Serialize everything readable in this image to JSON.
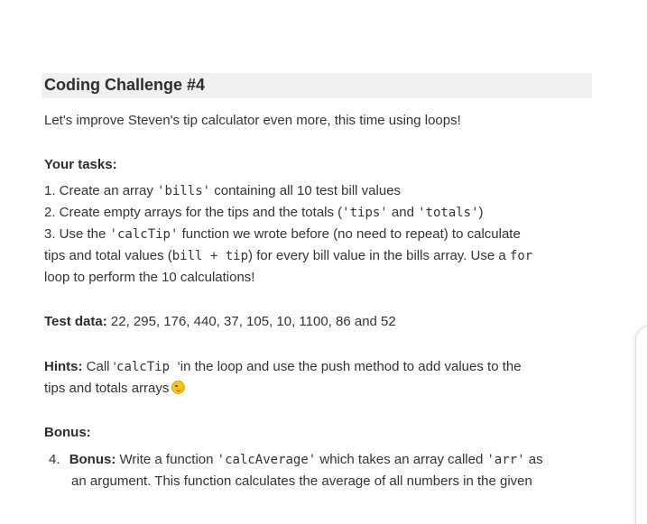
{
  "title": "Coding Challenge #4",
  "intro": "Let's improve Steven's tip calculator even more, this time using loops!",
  "tasks_heading": "Your tasks:",
  "task1": {
    "prefix": "1. Create an array ",
    "code": "'bills'",
    "suffix": " containing all 10 test bill values"
  },
  "task2": {
    "prefix": "2. Create empty arrays for the tips and the totals (",
    "code1": "'tips'",
    "mid": " and ",
    "code2": "'totals'",
    "suffix": ")"
  },
  "task3": {
    "l1_prefix": "3. Use the ",
    "l1_code": "'calcTip'",
    "l1_suffix": " function we wrote before (no need to repeat) to calculate",
    "l2_prefix": "tips and total values (",
    "l2_code": "bill + tip",
    "l2_suffix": ") for every bill value in the bills array. Use a ",
    "l2_code2": "for",
    "l3": "loop to perform the 10 calculations!"
  },
  "test_data": {
    "label": "Test data:",
    "value": " 22, 295, 176, 440, 37, 105, 10, 1100, 86 and 52"
  },
  "hints": {
    "label": "Hints:",
    "l1_prefix": " Call ‘",
    "l1_code": "calcTip ",
    "l1_suffix": "‘in the loop and use the push method to add values to the",
    "l2": "tips and totals arrays",
    "emoji": "winking-face"
  },
  "bonus_heading": "Bonus:",
  "bonus4": {
    "num": "4.",
    "label": "Bonus:",
    "l1_prefix": " Write a function ",
    "l1_code": "'calcAverage'",
    "l1_mid": " which takes an array called ",
    "l1_code2": "'arr'",
    "l1_suffix": " as",
    "l2": "an argument. This function calculates the average of all numbers in the given"
  }
}
